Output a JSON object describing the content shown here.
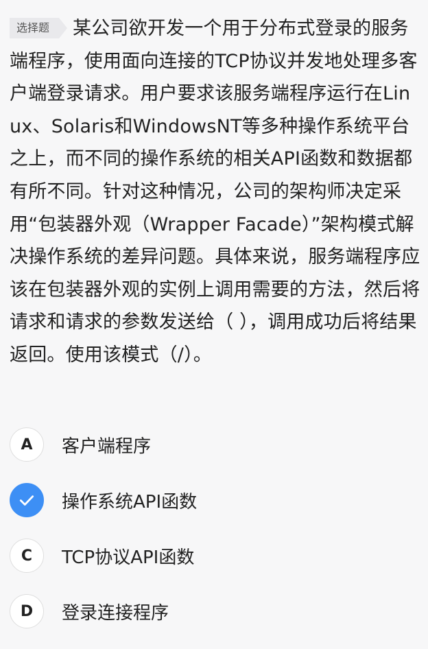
{
  "question": {
    "tag": "选择题",
    "text": "某公司欲开发一个用于分布式登录的服务端程序，使用面向连接的TCP协议并发地处理多客户端登录请求。用户要求该服务端程序运行在Linux、Solaris和WindowsNT等多种操作系统平台之上，而不同的操作系统的相关API函数和数据都有所不同。针对这种情况，公司的架构师决定采用“包装器外观（Wrapper Facade）”架构模式解决操作系统的差异问题。具体来说，服务端程序应该在包装器外观的实例上调用需要的方法，然后将请求和请求的参数发送给（ ），调用成功后将结果返回。使用该模式（/）。"
  },
  "options": [
    {
      "letter": "A",
      "text": "客户端程序",
      "selected": false
    },
    {
      "letter": "B",
      "text": "操作系统API函数",
      "selected": true,
      "icon": "check-icon"
    },
    {
      "letter": "C",
      "text": "TCP协议API函数",
      "selected": false
    },
    {
      "letter": "D",
      "text": "登录连接程序",
      "selected": false
    }
  ],
  "colors": {
    "accent": "#3d8ff5",
    "background": "#f7f7f8"
  }
}
